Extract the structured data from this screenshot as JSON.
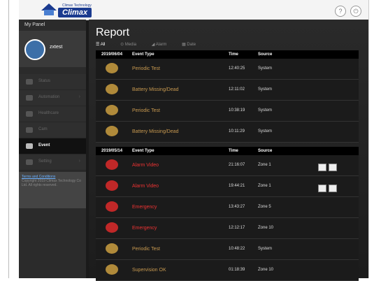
{
  "header": {
    "logo_text": "Climax",
    "logo_sub": "Climax Technology",
    "help_icon": "?",
    "logout_icon": "⏻"
  },
  "sidebar": {
    "my_panel": "My Panel",
    "username": "zxtest",
    "items": [
      {
        "label": "Status",
        "icon": "shield-icon"
      },
      {
        "label": "Automation",
        "icon": "automation-icon"
      },
      {
        "label": "Healthcare",
        "icon": "heart-icon"
      },
      {
        "label": "Cam",
        "icon": "camera-icon"
      },
      {
        "label": "Event",
        "icon": "event-icon"
      },
      {
        "label": "Setting",
        "icon": "gear-icon"
      }
    ],
    "terms": "Terms and Conditions",
    "copyright": "Copyright 2019 Climax Technology Co Ltd. All rights reserved."
  },
  "main": {
    "title": "Report",
    "filters": [
      "All",
      "Media",
      "Alarm",
      "Date"
    ],
    "groups": [
      {
        "date": "2019/06/04",
        "headers": {
          "event": "Event Type",
          "time": "Time",
          "source": "Source"
        },
        "rows": [
          {
            "event": "Periodic Test",
            "time": "12:40:25",
            "source": "System",
            "color": "gold"
          },
          {
            "event": "Battery Missing/Dead",
            "time": "12:11:02",
            "source": "System",
            "color": "gold"
          },
          {
            "event": "Periodic Test",
            "time": "10:38:19",
            "source": "System",
            "color": "gold"
          },
          {
            "event": "Battery Missing/Dead",
            "time": "10:11:29",
            "source": "System",
            "color": "gold"
          }
        ]
      },
      {
        "date": "2019/05/14",
        "headers": {
          "event": "Event Type",
          "time": "Time",
          "source": "Source"
        },
        "rows": [
          {
            "event": "Alarm Video",
            "time": "21:16:07",
            "source": "Zone 1",
            "color": "red",
            "media": true
          },
          {
            "event": "Alarm Video",
            "time": "19:44:21",
            "source": "Zone 1",
            "color": "red",
            "media": true
          },
          {
            "event": "Emergency",
            "time": "13:43:27",
            "source": "Zone 5",
            "color": "red"
          },
          {
            "event": "Emergency",
            "time": "12:12:17",
            "source": "Zone 10",
            "color": "red"
          },
          {
            "event": "Periodic Test",
            "time": "10:48:22",
            "source": "System",
            "color": "gold"
          },
          {
            "event": "Supervision OK",
            "time": "01:18:39",
            "source": "Zone 10",
            "color": "gold"
          }
        ]
      }
    ]
  },
  "colors": {
    "gold": "#c99a50",
    "red": "#ee3333",
    "brand": "#1a3a8f"
  }
}
